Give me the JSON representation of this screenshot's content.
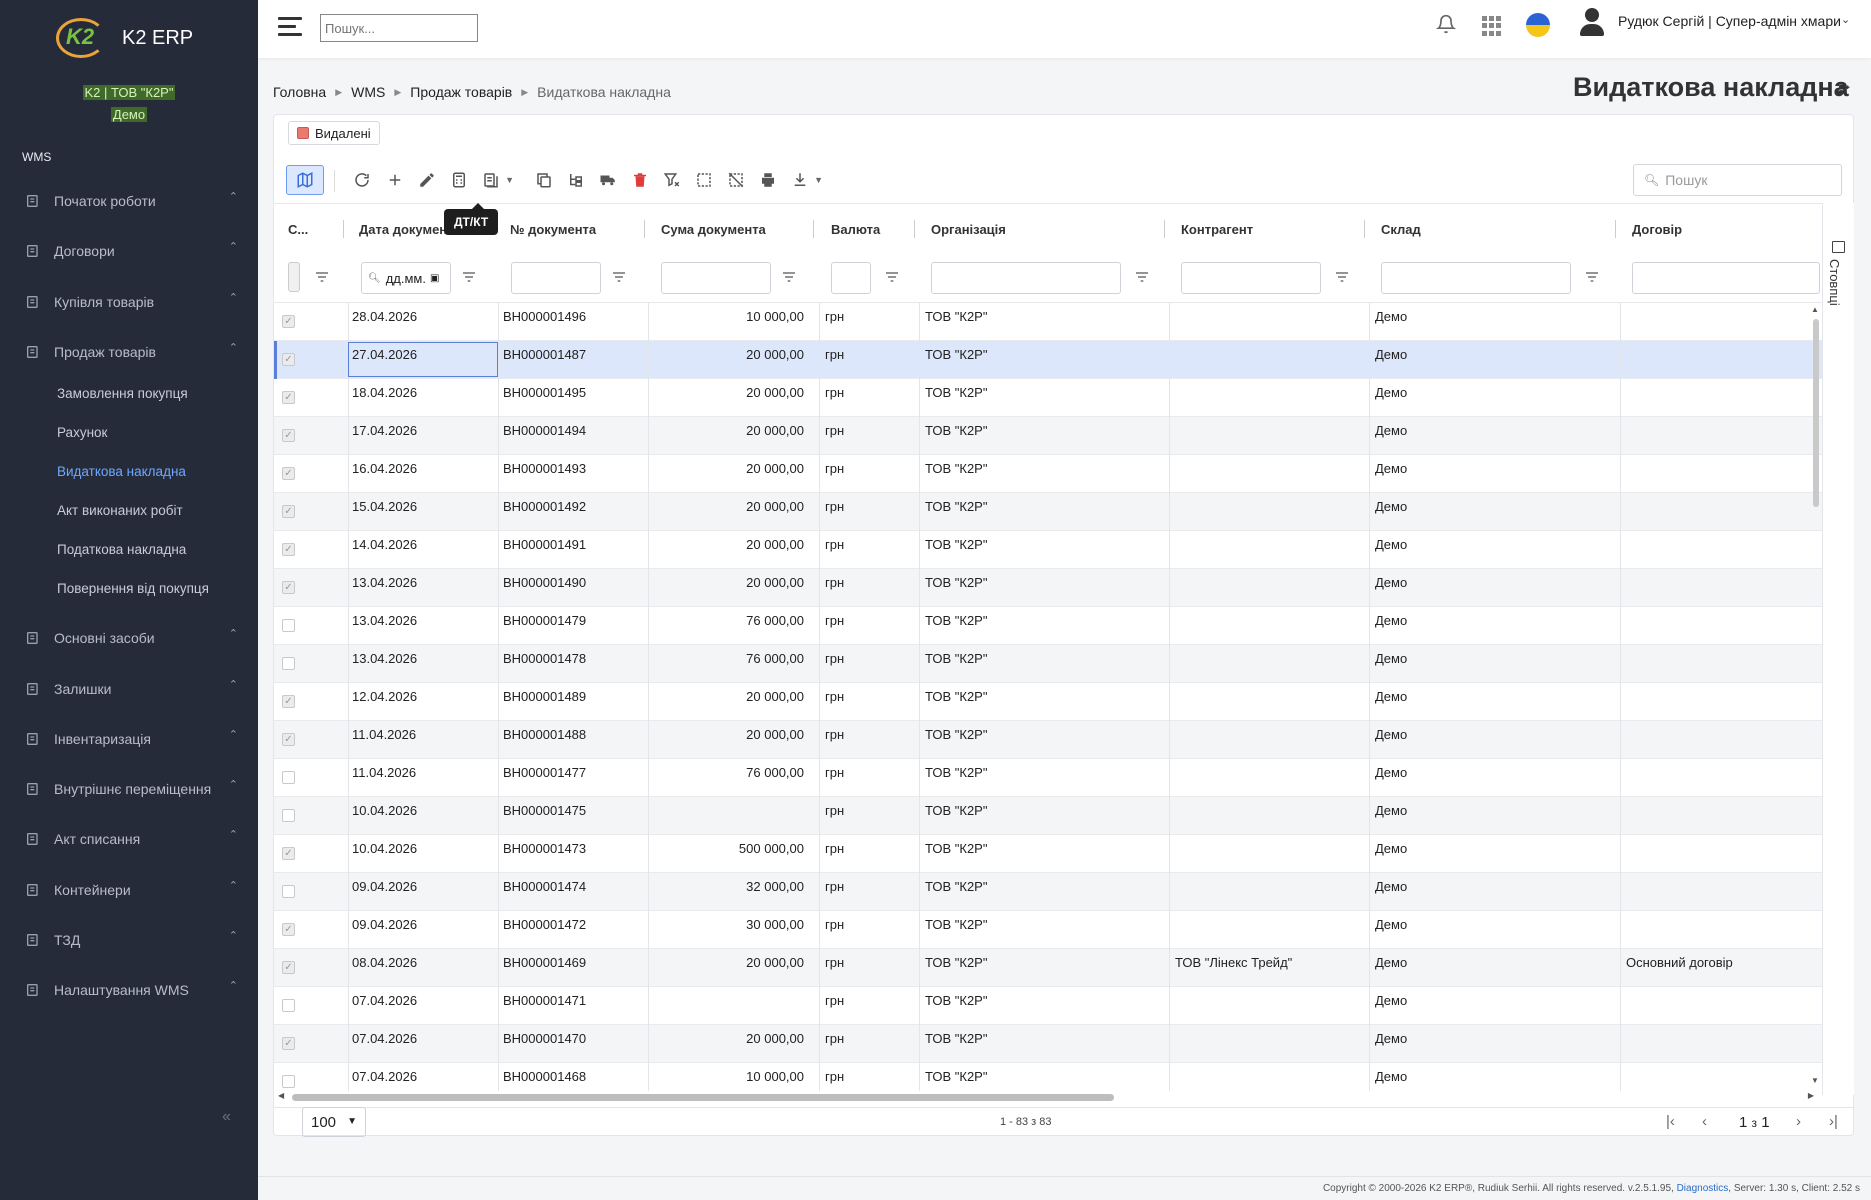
{
  "app": {
    "name": "K2 ERP",
    "logo_mark": "K2"
  },
  "company": {
    "line1": "K2 | ТОВ \"К2Р\"",
    "line2": "Демо"
  },
  "sidebar": {
    "section": "WMS",
    "items": [
      {
        "label": "Початок роботи",
        "icon": "start-icon"
      },
      {
        "label": "Договори",
        "icon": "contracts-icon"
      },
      {
        "label": "Купівля товарів",
        "icon": "purchase-icon"
      },
      {
        "label": "Продаж товарів",
        "icon": "sales-icon"
      },
      {
        "label": "Основні засоби",
        "icon": "assets-icon"
      },
      {
        "label": "Залишки",
        "icon": "stock-icon"
      },
      {
        "label": "Інвентаризація",
        "icon": "inventory-icon"
      },
      {
        "label": "Внутрішнє переміщення",
        "icon": "transfer-icon"
      },
      {
        "label": "Акт списання",
        "icon": "writeoff-icon"
      },
      {
        "label": "Контейнери",
        "icon": "containers-icon"
      },
      {
        "label": "ТЗД",
        "icon": "scanner-icon"
      },
      {
        "label": "Налаштування WMS",
        "icon": "settings-icon"
      }
    ],
    "sub_items": [
      {
        "label": "Замовлення покупця"
      },
      {
        "label": "Рахунок"
      },
      {
        "label": "Видаткова накладна"
      },
      {
        "label": "Акт виконаних робіт"
      },
      {
        "label": "Податкова накладна"
      },
      {
        "label": "Повернення від покупця"
      }
    ],
    "collapse": "«"
  },
  "topbar": {
    "search_placeholder": "Пошук...",
    "user": "Рудюк Сергій | Супер-адмін хмари"
  },
  "breadcrumb": [
    "Головна",
    "WMS",
    "Продаж товарів",
    "Видаткова накладна"
  ],
  "page_title": "Видаткова накладна",
  "filter_chip": "Видалені",
  "tooltip": "ДТ/КТ",
  "card_search_placeholder": "Пошук",
  "columns": [
    "С...",
    "Дата документа",
    "№ документа",
    "Сума документа",
    "Валюта",
    "Організація",
    "Контрагент",
    "Склад",
    "Договір"
  ],
  "date_filter_placeholder": "дд.мм.",
  "columns_panel_label": "Стовпці",
  "rows": [
    {
      "checked": true,
      "date": "28.04.2026",
      "number": "ВН000001496",
      "sum": "10 000,00",
      "currency": "грн",
      "org": "ТОВ \"К2Р\"",
      "counterparty": "",
      "warehouse": "Демо",
      "contract": ""
    },
    {
      "checked": true,
      "date": "27.04.2026",
      "number": "ВН000001487",
      "sum": "20 000,00",
      "currency": "грн",
      "org": "ТОВ \"К2Р\"",
      "counterparty": "",
      "warehouse": "Демо",
      "contract": ""
    },
    {
      "checked": true,
      "date": "18.04.2026",
      "number": "ВН000001495",
      "sum": "20 000,00",
      "currency": "грн",
      "org": "ТОВ \"К2Р\"",
      "counterparty": "",
      "warehouse": "Демо",
      "contract": ""
    },
    {
      "checked": true,
      "date": "17.04.2026",
      "number": "ВН000001494",
      "sum": "20 000,00",
      "currency": "грн",
      "org": "ТОВ \"К2Р\"",
      "counterparty": "",
      "warehouse": "Демо",
      "contract": ""
    },
    {
      "checked": true,
      "date": "16.04.2026",
      "number": "ВН000001493",
      "sum": "20 000,00",
      "currency": "грн",
      "org": "ТОВ \"К2Р\"",
      "counterparty": "",
      "warehouse": "Демо",
      "contract": ""
    },
    {
      "checked": true,
      "date": "15.04.2026",
      "number": "ВН000001492",
      "sum": "20 000,00",
      "currency": "грн",
      "org": "ТОВ \"К2Р\"",
      "counterparty": "",
      "warehouse": "Демо",
      "contract": ""
    },
    {
      "checked": true,
      "date": "14.04.2026",
      "number": "ВН000001491",
      "sum": "20 000,00",
      "currency": "грн",
      "org": "ТОВ \"К2Р\"",
      "counterparty": "",
      "warehouse": "Демо",
      "contract": ""
    },
    {
      "checked": true,
      "date": "13.04.2026",
      "number": "ВН000001490",
      "sum": "20 000,00",
      "currency": "грн",
      "org": "ТОВ \"К2Р\"",
      "counterparty": "",
      "warehouse": "Демо",
      "contract": ""
    },
    {
      "checked": false,
      "date": "13.04.2026",
      "number": "ВН000001479",
      "sum": "76 000,00",
      "currency": "грн",
      "org": "ТОВ \"К2Р\"",
      "counterparty": "",
      "warehouse": "Демо",
      "contract": ""
    },
    {
      "checked": false,
      "date": "13.04.2026",
      "number": "ВН000001478",
      "sum": "76 000,00",
      "currency": "грн",
      "org": "ТОВ \"К2Р\"",
      "counterparty": "",
      "warehouse": "Демо",
      "contract": ""
    },
    {
      "checked": true,
      "date": "12.04.2026",
      "number": "ВН000001489",
      "sum": "20 000,00",
      "currency": "грн",
      "org": "ТОВ \"К2Р\"",
      "counterparty": "",
      "warehouse": "Демо",
      "contract": ""
    },
    {
      "checked": true,
      "date": "11.04.2026",
      "number": "ВН000001488",
      "sum": "20 000,00",
      "currency": "грн",
      "org": "ТОВ \"К2Р\"",
      "counterparty": "",
      "warehouse": "Демо",
      "contract": ""
    },
    {
      "checked": false,
      "date": "11.04.2026",
      "number": "ВН000001477",
      "sum": "76 000,00",
      "currency": "грн",
      "org": "ТОВ \"К2Р\"",
      "counterparty": "",
      "warehouse": "Демо",
      "contract": ""
    },
    {
      "checked": false,
      "date": "10.04.2026",
      "number": "ВН000001475",
      "sum": "",
      "currency": "грн",
      "org": "ТОВ \"К2Р\"",
      "counterparty": "",
      "warehouse": "Демо",
      "contract": ""
    },
    {
      "checked": true,
      "date": "10.04.2026",
      "number": "ВН000001473",
      "sum": "500 000,00",
      "currency": "грн",
      "org": "ТОВ \"К2Р\"",
      "counterparty": "",
      "warehouse": "Демо",
      "contract": ""
    },
    {
      "checked": false,
      "date": "09.04.2026",
      "number": "ВН000001474",
      "sum": "32 000,00",
      "currency": "грн",
      "org": "ТОВ \"К2Р\"",
      "counterparty": "",
      "warehouse": "Демо",
      "contract": ""
    },
    {
      "checked": true,
      "date": "09.04.2026",
      "number": "ВН000001472",
      "sum": "30 000,00",
      "currency": "грн",
      "org": "ТОВ \"К2Р\"",
      "counterparty": "",
      "warehouse": "Демо",
      "contract": ""
    },
    {
      "checked": true,
      "date": "08.04.2026",
      "number": "ВН000001469",
      "sum": "20 000,00",
      "currency": "грн",
      "org": "ТОВ \"К2Р\"",
      "counterparty": "ТОВ \"Лінекс Трейд\"",
      "warehouse": "Демо",
      "contract": "Основний договір"
    },
    {
      "checked": false,
      "date": "07.04.2026",
      "number": "ВН000001471",
      "sum": "",
      "currency": "грн",
      "org": "ТОВ \"К2Р\"",
      "counterparty": "",
      "warehouse": "Демо",
      "contract": ""
    },
    {
      "checked": true,
      "date": "07.04.2026",
      "number": "ВН000001470",
      "sum": "20 000,00",
      "currency": "грн",
      "org": "ТОВ \"К2Р\"",
      "counterparty": "",
      "warehouse": "Демо",
      "contract": ""
    },
    {
      "checked": false,
      "date": "07.04.2026",
      "number": "ВН000001468",
      "sum": "10 000,00",
      "currency": "грн",
      "org": "ТОВ \"К2Р\"",
      "counterparty": "",
      "warehouse": "Демо",
      "contract": ""
    }
  ],
  "pager": {
    "page_size": "100",
    "range": "1 - 83 з 83",
    "page": "1",
    "of": "з",
    "total_pages": "1"
  },
  "copyright": {
    "text": "Copyright © 2000-2026 K2 ERP®, Rudiuk Serhii. All rights reserved. v.2.5.1.95,",
    "link": "Diagnostics",
    "stats": ", Server: 1.30 s, Client: 2.52 s"
  },
  "colors": {
    "sidebar_bg": "#262b3a",
    "accent": "#6ea8ff",
    "selected_row": "#dce7fb",
    "delete": "#e03c3c"
  }
}
